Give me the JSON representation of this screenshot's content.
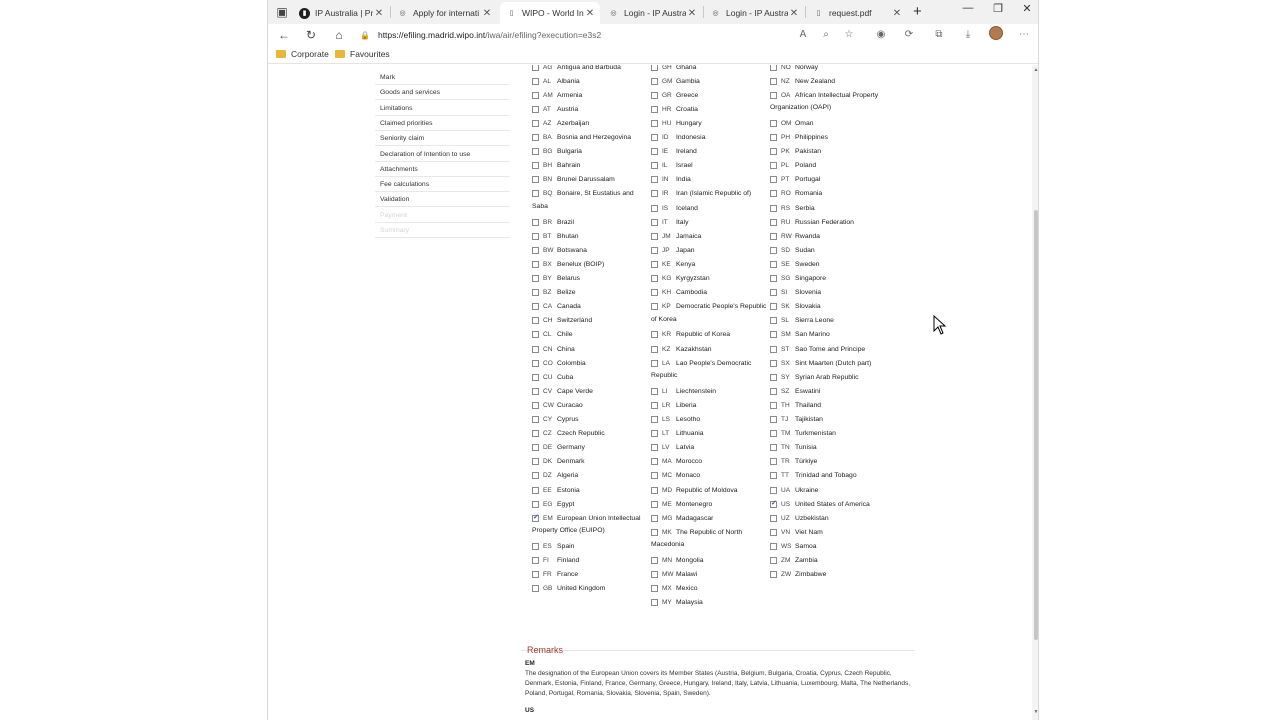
{
  "browser": {
    "tabs": [
      {
        "title": "IP Australia | Prote",
        "favicon": "ip-australia-icon",
        "active": false
      },
      {
        "title": "Apply for internati",
        "favicon": "wipo-icon",
        "active": false
      },
      {
        "title": "WIPO - World Inte",
        "favicon": "document-icon",
        "active": true
      },
      {
        "title": "Login - IP Australi",
        "favicon": "wipo-icon",
        "active": false
      },
      {
        "title": "Login - IP Australi",
        "favicon": "wipo-icon",
        "active": false
      },
      {
        "title": "request.pdf",
        "favicon": "pdf-icon",
        "active": false
      }
    ],
    "address": {
      "host": "https://efiling.madrid.wipo.int",
      "path": "/iwa/air/efiling?execution=e3s2"
    },
    "favourites": [
      {
        "label": "Corporate"
      },
      {
        "label": "Favourites"
      }
    ]
  },
  "sidebar": {
    "items": [
      {
        "label": "Mark",
        "enabled": true
      },
      {
        "label": "Goods and services",
        "enabled": true
      },
      {
        "label": "Limitations",
        "enabled": true
      },
      {
        "label": "Claimed priorities",
        "enabled": true
      },
      {
        "label": "Seniority claim",
        "enabled": true
      },
      {
        "label": "Declaration of Intention to use",
        "enabled": true
      },
      {
        "label": "Attachments",
        "enabled": true
      },
      {
        "label": "Fee calculations",
        "enabled": true
      },
      {
        "label": "Validation",
        "enabled": true
      },
      {
        "label": "Payment",
        "enabled": false
      },
      {
        "label": "Summary",
        "enabled": false
      }
    ]
  },
  "countries": {
    "col1": [
      {
        "code": "AG",
        "name": "Antigua and Barbuda",
        "checked": false
      },
      {
        "code": "AL",
        "name": "Albania",
        "checked": false
      },
      {
        "code": "AM",
        "name": "Armenia",
        "checked": false
      },
      {
        "code": "AT",
        "name": "Austria",
        "checked": false
      },
      {
        "code": "AZ",
        "name": "Azerbaijan",
        "checked": false
      },
      {
        "code": "BA",
        "name": "Bosnia and Herzegovina",
        "checked": false
      },
      {
        "code": "BG",
        "name": "Bulgaria",
        "checked": false
      },
      {
        "code": "BH",
        "name": "Bahrain",
        "checked": false
      },
      {
        "code": "BN",
        "name": "Brunei Darussalam",
        "checked": false
      },
      {
        "code": "BQ",
        "name": "Bonaire, St Eustatius and",
        "cont": "Saba",
        "checked": false
      },
      {
        "code": "BR",
        "name": "Brazil",
        "checked": false
      },
      {
        "code": "BT",
        "name": "Bhutan",
        "checked": false
      },
      {
        "code": "BW",
        "name": "Botswana",
        "checked": false
      },
      {
        "code": "BX",
        "name": "Benelux (BOIP)",
        "checked": false
      },
      {
        "code": "BY",
        "name": "Belarus",
        "checked": false
      },
      {
        "code": "BZ",
        "name": "Belize",
        "checked": false
      },
      {
        "code": "CA",
        "name": "Canada",
        "checked": false
      },
      {
        "code": "CH",
        "name": "Switzerland",
        "checked": false
      },
      {
        "code": "CL",
        "name": "Chile",
        "checked": false
      },
      {
        "code": "CN",
        "name": "China",
        "checked": false
      },
      {
        "code": "CO",
        "name": "Colombia",
        "checked": false
      },
      {
        "code": "CU",
        "name": "Cuba",
        "checked": false
      },
      {
        "code": "CV",
        "name": "Cape Verde",
        "checked": false
      },
      {
        "code": "CW",
        "name": "Curacao",
        "checked": false
      },
      {
        "code": "CY",
        "name": "Cyprus",
        "checked": false
      },
      {
        "code": "CZ",
        "name": "Czech Republic",
        "checked": false
      },
      {
        "code": "DE",
        "name": "Germany",
        "checked": false
      },
      {
        "code": "DK",
        "name": "Denmark",
        "checked": false
      },
      {
        "code": "DZ",
        "name": "Algeria",
        "checked": false
      },
      {
        "code": "EE",
        "name": "Estonia",
        "checked": false
      },
      {
        "code": "EG",
        "name": "Egypt",
        "checked": false
      },
      {
        "code": "EM",
        "name": "European Union Intellectual",
        "cont": "Property Office (EUIPO)",
        "checked": true
      },
      {
        "code": "ES",
        "name": "Spain",
        "checked": false
      },
      {
        "code": "FI",
        "name": "Finland",
        "checked": false
      },
      {
        "code": "FR",
        "name": "France",
        "checked": false
      },
      {
        "code": "GB",
        "name": "United Kingdom",
        "checked": false
      }
    ],
    "col2": [
      {
        "code": "GH",
        "name": "Ghana",
        "checked": false
      },
      {
        "code": "GM",
        "name": "Gambia",
        "checked": false
      },
      {
        "code": "GR",
        "name": "Greece",
        "checked": false
      },
      {
        "code": "HR",
        "name": "Croatia",
        "checked": false
      },
      {
        "code": "HU",
        "name": "Hungary",
        "checked": false
      },
      {
        "code": "ID",
        "name": "Indonesia",
        "checked": false
      },
      {
        "code": "IE",
        "name": "Ireland",
        "checked": false
      },
      {
        "code": "IL",
        "name": "Israel",
        "checked": false
      },
      {
        "code": "IN",
        "name": "India",
        "checked": false
      },
      {
        "code": "IR",
        "name": "Iran (Islamic Republic of)",
        "checked": false
      },
      {
        "code": "IS",
        "name": "Iceland",
        "checked": false
      },
      {
        "code": "IT",
        "name": "Italy",
        "checked": false
      },
      {
        "code": "JM",
        "name": "Jamaica",
        "checked": false
      },
      {
        "code": "JP",
        "name": "Japan",
        "checked": false
      },
      {
        "code": "KE",
        "name": "Kenya",
        "checked": false
      },
      {
        "code": "KG",
        "name": "Kyrgyzstan",
        "checked": false
      },
      {
        "code": "KH",
        "name": "Cambodia",
        "checked": false
      },
      {
        "code": "KP",
        "name": "Democratic People's Republic",
        "cont": "of Korea",
        "checked": false
      },
      {
        "code": "KR",
        "name": "Republic of Korea",
        "checked": false
      },
      {
        "code": "KZ",
        "name": "Kazakhstan",
        "checked": false
      },
      {
        "code": "LA",
        "name": "Lao People's Democratic",
        "cont": "Republic",
        "checked": false
      },
      {
        "code": "LI",
        "name": "Liechtenstein",
        "checked": false
      },
      {
        "code": "LR",
        "name": "Liberia",
        "checked": false
      },
      {
        "code": "LS",
        "name": "Lesotho",
        "checked": false
      },
      {
        "code": "LT",
        "name": "Lithuania",
        "checked": false
      },
      {
        "code": "LV",
        "name": "Latvia",
        "checked": false
      },
      {
        "code": "MA",
        "name": "Morocco",
        "checked": false
      },
      {
        "code": "MC",
        "name": "Monaco",
        "checked": false
      },
      {
        "code": "MD",
        "name": "Republic of Moldova",
        "checked": false
      },
      {
        "code": "ME",
        "name": "Montenegro",
        "checked": false
      },
      {
        "code": "MG",
        "name": "Madagascar",
        "checked": false
      },
      {
        "code": "MK",
        "name": "The Republic of North",
        "cont": "Macedonia",
        "checked": false
      },
      {
        "code": "MN",
        "name": "Mongolia",
        "checked": false
      },
      {
        "code": "MW",
        "name": "Malawi",
        "checked": false
      },
      {
        "code": "MX",
        "name": "Mexico",
        "checked": false
      },
      {
        "code": "MY",
        "name": "Malaysia",
        "checked": false
      }
    ],
    "col3": [
      {
        "code": "NO",
        "name": "Norway",
        "checked": false
      },
      {
        "code": "NZ",
        "name": "New Zealand",
        "checked": false
      },
      {
        "code": "OA",
        "name": "African Intellectual Property",
        "cont": "Organization (OAPI)",
        "checked": false
      },
      {
        "code": "OM",
        "name": "Oman",
        "checked": false
      },
      {
        "code": "PH",
        "name": "Philippines",
        "checked": false
      },
      {
        "code": "PK",
        "name": "Pakistan",
        "checked": false
      },
      {
        "code": "PL",
        "name": "Poland",
        "checked": false
      },
      {
        "code": "PT",
        "name": "Portugal",
        "checked": false
      },
      {
        "code": "RO",
        "name": "Romania",
        "checked": false
      },
      {
        "code": "RS",
        "name": "Serbia",
        "checked": false
      },
      {
        "code": "RU",
        "name": "Russian Federation",
        "checked": false
      },
      {
        "code": "RW",
        "name": "Rwanda",
        "checked": false
      },
      {
        "code": "SD",
        "name": "Sudan",
        "checked": false
      },
      {
        "code": "SE",
        "name": "Sweden",
        "checked": false
      },
      {
        "code": "SG",
        "name": "Singapore",
        "checked": false
      },
      {
        "code": "SI",
        "name": "Slovenia",
        "checked": false
      },
      {
        "code": "SK",
        "name": "Slovakia",
        "checked": false
      },
      {
        "code": "SL",
        "name": "Sierra Leone",
        "checked": false
      },
      {
        "code": "SM",
        "name": "San Marino",
        "checked": false
      },
      {
        "code": "ST",
        "name": "Sao Tome and Principe",
        "checked": false
      },
      {
        "code": "SX",
        "name": "Sint Maarten (Dutch part)",
        "checked": false
      },
      {
        "code": "SY",
        "name": "Syrian Arab Republic",
        "checked": false
      },
      {
        "code": "SZ",
        "name": "Eswatini",
        "checked": false
      },
      {
        "code": "TH",
        "name": "Thailand",
        "checked": false
      },
      {
        "code": "TJ",
        "name": "Tajikistan",
        "checked": false
      },
      {
        "code": "TM",
        "name": "Turkmenistan",
        "checked": false
      },
      {
        "code": "TN",
        "name": "Tunisia",
        "checked": false
      },
      {
        "code": "TR",
        "name": "Türkiye",
        "checked": false
      },
      {
        "code": "TT",
        "name": "Trinidad and Tobago",
        "checked": false
      },
      {
        "code": "UA",
        "name": "Ukraine",
        "checked": false
      },
      {
        "code": "US",
        "name": "United States of America",
        "checked": true
      },
      {
        "code": "UZ",
        "name": "Uzbekistan",
        "checked": false
      },
      {
        "code": "VN",
        "name": "Viet Nam",
        "checked": false
      },
      {
        "code": "WS",
        "name": "Samoa",
        "checked": false
      },
      {
        "code": "ZM",
        "name": "Zambia",
        "checked": false
      },
      {
        "code": "ZW",
        "name": "Zimbabwe",
        "checked": false
      }
    ]
  },
  "remarks": {
    "title": "Remarks",
    "items": [
      {
        "code": "EM",
        "text": "The designation of the European Union covers its Member States (Austria, Belgium, Bulgaria, Croatia, Cyprus, Czech Republic, Denmark, Estonia, Finland, France, Germany, Greece, Hungary, Ireland, Italy, Latvia, Lithuania, Luxembourg, Malta, The Netherlands, Poland, Portugal, Romania, Slovakia, Slovenia, Spain, Sweden)."
      },
      {
        "code": "US",
        "text": ""
      }
    ]
  },
  "colors": {
    "remarks_title": "#a3392d",
    "check": "#2d5a9e",
    "folder": "#e8b73a"
  }
}
